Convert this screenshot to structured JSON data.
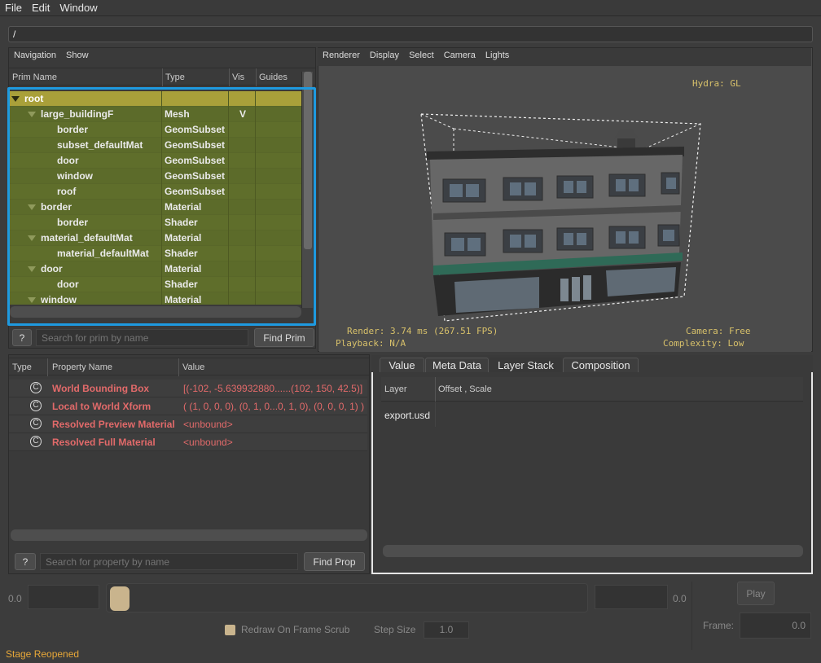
{
  "menubar": {
    "items": [
      "File",
      "Edit",
      "Window"
    ]
  },
  "path": "/",
  "nav": {
    "menu": [
      "Navigation",
      "Show"
    ],
    "columns": [
      "Prim Name",
      "Type",
      "Vis",
      "Guides"
    ],
    "rows": [
      {
        "name": "root",
        "type": "",
        "vis": "",
        "depth": 0,
        "expander": true
      },
      {
        "name": "large_buildingF",
        "type": "Mesh",
        "vis": "V",
        "depth": 1,
        "expander": true
      },
      {
        "name": "border",
        "type": "GeomSubset",
        "vis": "",
        "depth": 2,
        "expander": false
      },
      {
        "name": "subset_defaultMat",
        "type": "GeomSubset",
        "vis": "",
        "depth": 2,
        "expander": false
      },
      {
        "name": "door",
        "type": "GeomSubset",
        "vis": "",
        "depth": 2,
        "expander": false
      },
      {
        "name": "window",
        "type": "GeomSubset",
        "vis": "",
        "depth": 2,
        "expander": false
      },
      {
        "name": "roof",
        "type": "GeomSubset",
        "vis": "",
        "depth": 2,
        "expander": false
      },
      {
        "name": "border",
        "type": "Material",
        "vis": "",
        "depth": 1,
        "expander": true
      },
      {
        "name": "border",
        "type": "Shader",
        "vis": "",
        "depth": 2,
        "expander": false
      },
      {
        "name": "material_defaultMat",
        "type": "Material",
        "vis": "",
        "depth": 1,
        "expander": true
      },
      {
        "name": "material_defaultMat",
        "type": "Shader",
        "vis": "",
        "depth": 2,
        "expander": false
      },
      {
        "name": "door",
        "type": "Material",
        "vis": "",
        "depth": 1,
        "expander": true
      },
      {
        "name": "door",
        "type": "Shader",
        "vis": "",
        "depth": 2,
        "expander": false
      },
      {
        "name": "window",
        "type": "Material",
        "vis": "",
        "depth": 1,
        "expander": true
      }
    ],
    "help_label": "?",
    "search_placeholder": "Search for prim by name",
    "find_label": "Find Prim"
  },
  "viewport": {
    "menu": [
      "Renderer",
      "Display",
      "Select",
      "Camera",
      "Lights"
    ],
    "hud_renderer": "Hydra: GL",
    "hud_render": "Render: 3.74 ms (267.51 FPS)",
    "hud_playback": "Playback: N/A",
    "hud_camera": "Camera: Free",
    "hud_complexity": "Complexity: Low"
  },
  "properties": {
    "columns": [
      "Type",
      "Property Name",
      "Value"
    ],
    "rows": [
      {
        "icon": "C",
        "name": "World Bounding Box",
        "value": "[(-102, -5.639932880......(102, 150, 42.5)]"
      },
      {
        "icon": "C",
        "name": "Local to World Xform",
        "value": "( (1, 0, 0, 0), (0, 1, 0...0, 1, 0), (0, 0, 0, 1) )"
      },
      {
        "icon": "C",
        "name": "Resolved Preview Material",
        "value": "<unbound>"
      },
      {
        "icon": "C",
        "name": "Resolved Full Material",
        "value": "<unbound>"
      }
    ],
    "help_label": "?",
    "search_placeholder": "Search for property by name",
    "find_label": "Find Prop"
  },
  "inspector": {
    "tabs": [
      "Value",
      "Meta Data",
      "Layer Stack",
      "Composition"
    ],
    "active_tab": "Layer Stack",
    "columns": [
      "Layer",
      "Offset , Scale"
    ],
    "rows": [
      {
        "layer": "export.usd",
        "offset": ""
      }
    ]
  },
  "timeline": {
    "start": "0.0",
    "end": "0.0",
    "play_label": "Play",
    "redraw_label": "Redraw On Frame Scrub",
    "step_label": "Step Size",
    "step_value": "1.0",
    "frame_label": "Frame:",
    "frame_value": "0.0"
  },
  "status": "Stage Reopened",
  "colors": {
    "selection_outline": "#1e9ae0",
    "tree_bg": "#5f6e2b",
    "selected_row": "#a9a03a",
    "property_text": "#e26a6a",
    "hud_text": "#d7c06a",
    "status_text": "#e8a838"
  }
}
